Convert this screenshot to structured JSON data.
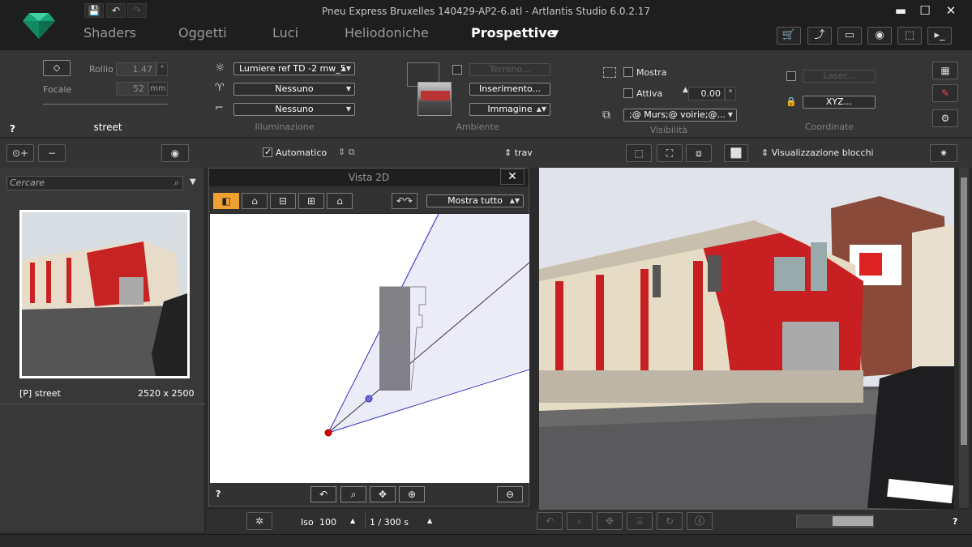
{
  "window": {
    "title": "Pneu Express Bruxelles 140429-AP2-6.atl - Artlantis Studio 6.0.2.17",
    "minimize": "▬",
    "maximize": "☐",
    "close": "✕"
  },
  "quick": {
    "save": "💾",
    "undo": "↶",
    "redo": "↷"
  },
  "tabs": [
    {
      "label": "Shaders"
    },
    {
      "label": "Oggetti"
    },
    {
      "label": "Luci"
    },
    {
      "label": "Heliodoniche"
    },
    {
      "label": "Prospettive"
    }
  ],
  "tab_dropdown": "▼",
  "toolbar_icons": [
    "cart-icon",
    "export-icon",
    "screens-icon",
    "camera-icon",
    "crop-icon",
    "console-icon"
  ],
  "camera": {
    "rollio_label": "Rollio",
    "rollio_value": "1.47",
    "rollio_unit": "°",
    "focale_label": "Focale",
    "focale_value": "52",
    "focale_unit": "mm",
    "name": "street",
    "help": "?"
  },
  "lighting": {
    "group": "Illuminazione",
    "light": "Lumiere ref TD -2 mw_5",
    "option2": "Nessuno",
    "option3": "Nessuno"
  },
  "environment": {
    "group": "Ambiente",
    "terreno": "Terreno...",
    "inserimento": "Inserimento...",
    "immagine": "Immagine"
  },
  "visibility": {
    "group": "Visibilità",
    "mostra": "Mostra",
    "attiva": "Attiva",
    "attiva_value": "0.00",
    "attiva_unit": "°",
    "layers": ";@ Murs;@ voirie;@..."
  },
  "coords": {
    "group": "Coordinate",
    "laser": "Laser...",
    "xyz": "XYZ..."
  },
  "row2": {
    "automatico": "Automatico",
    "trav": "trav",
    "blocks": "Visualizzazione blocchi"
  },
  "left": {
    "search_placeholder": "Cercare",
    "item_label": "[P] street",
    "item_size": "2520 x 2500"
  },
  "vista2d": {
    "title": "Vista 2D",
    "close": "✕",
    "mostra": "Mostra tutto",
    "help": "?"
  },
  "bottom": {
    "iso_label": "Iso",
    "iso_value": "100",
    "shutter": "1 /  300 s",
    "help": "?"
  },
  "colors": {
    "accent": "#f0a030",
    "brand_green": "#1aa37a",
    "frustum": "#3030c0"
  }
}
